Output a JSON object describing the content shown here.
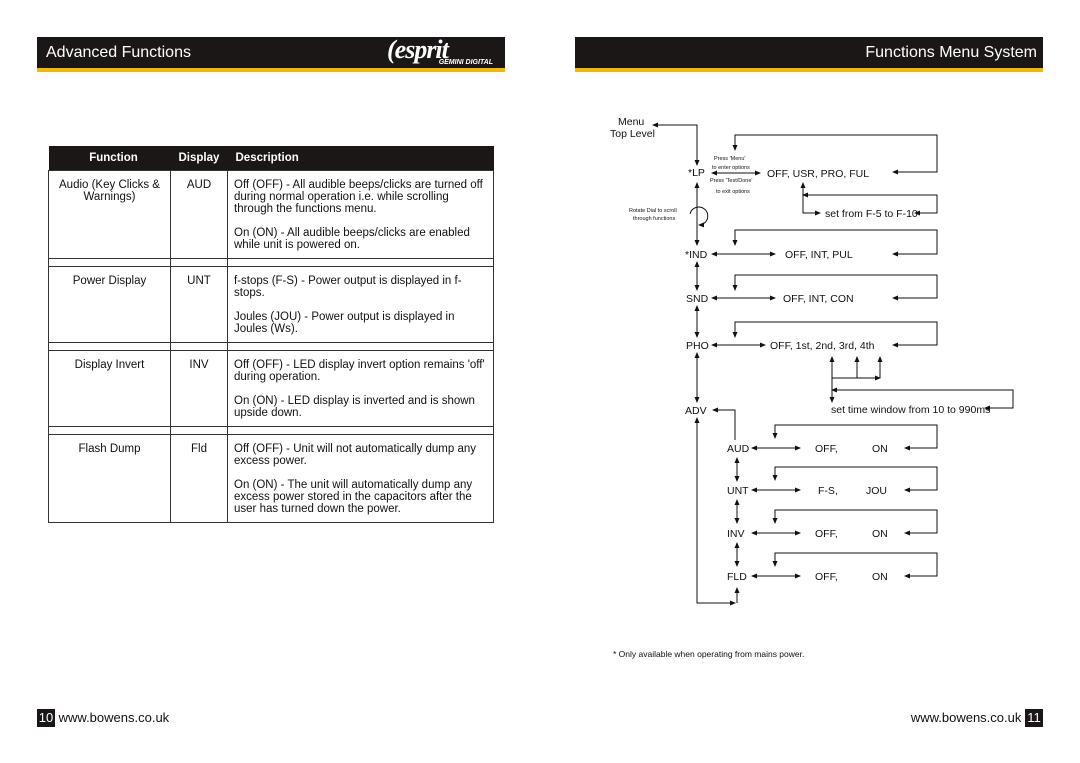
{
  "left": {
    "header": "Advanced Functions",
    "logo": {
      "brand": "esprit",
      "sub": "GEMINI DIGITAL"
    },
    "table": {
      "headers": [
        "Function",
        "Display",
        "Description"
      ],
      "rows": [
        {
          "function": "Audio (Key Clicks & Warnings)",
          "display": "AUD",
          "desc": [
            "Off (OFF) - All audible beeps/clicks are turned off during normal operation i.e. while scrolling through the functions menu.",
            "On (ON) - All audible beeps/clicks are enabled while unit is powered on."
          ]
        },
        {
          "function": "Power Display",
          "display": "UNT",
          "desc": [
            "f-stops (F-S) - Power output is displayed in f-stops.",
            "Joules (JOU) - Power output is displayed in Joules (Ws)."
          ]
        },
        {
          "function": "Display Invert",
          "display": "INV",
          "desc": [
            "Off (OFF) - LED display invert option remains 'off' during operation.",
            "On (ON) - LED display is inverted and is shown upside down."
          ]
        },
        {
          "function": "Flash Dump",
          "display": "Fld",
          "desc": [
            "Off (OFF) - Unit will not automatically dump any excess power.",
            "On (ON) - The unit will automatically dump any excess power stored in the capacitors after the user has turned down the power."
          ]
        }
      ]
    },
    "page": "10",
    "url": "www.bowens.co.uk"
  },
  "right": {
    "header": "Functions Menu System",
    "page": "11",
    "url": "www.bowens.co.uk",
    "diagram": {
      "menu": "Menu",
      "top_level": "Top Level",
      "press_menu": "Press 'Menu'",
      "to_enter": "to enter options",
      "press_test": "Press 'Test/Done'",
      "to_exit": "to exit options",
      "rotate": "Rotate Dial to scroll",
      "through": "through functions",
      "lp": "*LP",
      "lp_opts": "OFF,   USR,   PRO,   FUL",
      "lp_set": "set from F-5 to F-10",
      "ind": "*IND",
      "ind_opts": "OFF,   INT,   PUL",
      "snd": "SND",
      "snd_opts": "OFF,   INT,   CON",
      "pho": "PHO",
      "pho_opts": "OFF,   1st,   2nd,   3rd,   4th",
      "pho_set": "set time window from 10 to 990ms",
      "adv": "ADV",
      "aud": "AUD",
      "aud_a": "OFF,",
      "aud_b": "ON",
      "unt": "UNT",
      "unt_a": "F-S,",
      "unt_b": "JOU",
      "inv": "INV",
      "inv_a": "OFF,",
      "inv_b": "ON",
      "fld": "FLD",
      "fld_a": "OFF,",
      "fld_b": "ON"
    },
    "footnote": "* Only available when operating from mains power."
  }
}
